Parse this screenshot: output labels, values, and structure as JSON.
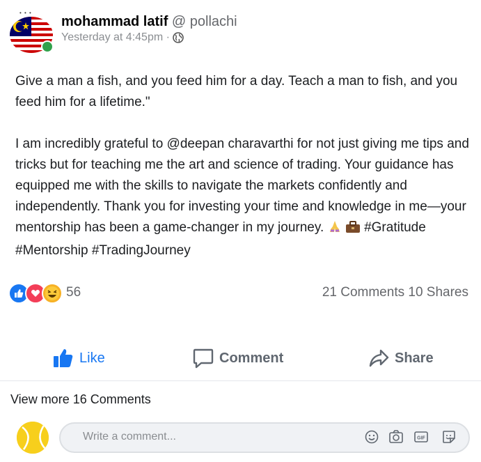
{
  "post": {
    "author_name": "mohammad latif",
    "location": "@ pollachi",
    "timestamp": "Yesterday at 4:45pm ·",
    "visibility_icon": "globe-icon",
    "text_p1": "Give a man a fish, and you feed him for a day. Teach a man to fish, and you feed him for a lifetime.\"",
    "text_p2": "I am incredibly grateful to @deepan charavarthi for not just giving me tips and tricks but for teaching me the art and science of trading. Your guidance has equipped me with the skills to navigate the markets confidently and independently. Thank you for investing your time and knowledge in me—your mentorship has been a game-changer in my journey.",
    "hashtags": "#Gratitude #Mentorship #TradingJourney",
    "avatar_icon": "malaysia-flag-icon"
  },
  "reactions": {
    "types": [
      "like",
      "love",
      "haha"
    ],
    "count": "56"
  },
  "stats": {
    "comments_shares": "21 Comments 10 Shares"
  },
  "actions": {
    "like": "Like",
    "comment": "Comment",
    "share": "Share"
  },
  "comments": {
    "view_more": "View more 16 Comments",
    "placeholder": "Write a comment...",
    "icons": [
      "smile-icon",
      "camera-icon",
      "gif-icon",
      "sticker-icon"
    ]
  },
  "colors": {
    "brand_blue": "#1877f2",
    "online_green": "#31a24c",
    "muted": "#65676b"
  }
}
